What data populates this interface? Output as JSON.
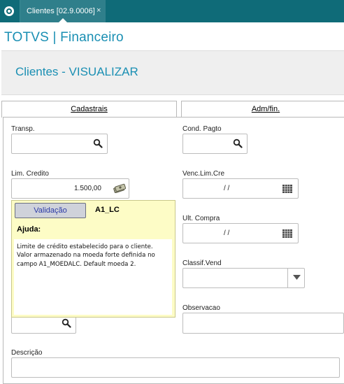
{
  "topbar": {
    "tab_label": "Clientes [02.9.0006]",
    "tab_close": "×",
    "bg_color": "#0f6b78"
  },
  "app": {
    "title": "TOTVS | Financeiro",
    "title_color": "#1a8fb3"
  },
  "page": {
    "title": "Clientes - VISUALIZAR"
  },
  "tabs": [
    {
      "label": "Cadastrais"
    },
    {
      "label": "Adm/fin."
    }
  ],
  "fields": {
    "transp": {
      "label": "Transp.",
      "value": ""
    },
    "cond_pagto": {
      "label": "Cond. Pagto",
      "value": ""
    },
    "lim_credito": {
      "label": "Lim. Credito",
      "value": "1.500,00"
    },
    "venc_lim_cre": {
      "label": "Venc.Lim.Cre",
      "value": "/ /"
    },
    "ult_compra": {
      "label": "Ult. Compra",
      "value": "/ /"
    },
    "classif_vend": {
      "label": "Classif.Vend",
      "value": ""
    },
    "observacao": {
      "label": "Observacao",
      "value": ""
    },
    "descricao": {
      "label": "Descrição",
      "value": ""
    }
  },
  "help": {
    "button_label": "Validação",
    "field_name": "A1_LC",
    "heading": "Ajuda:",
    "text": "Limite de crédito estabelecido para o cliente. Valor armazenado na moeda forte definida no campo A1_MOEDALC. Default moeda 2."
  },
  "icons": {
    "search": "search-icon",
    "calendar": "calendar-icon",
    "money": "money-icon",
    "dropdown": "chevron-down-icon"
  }
}
